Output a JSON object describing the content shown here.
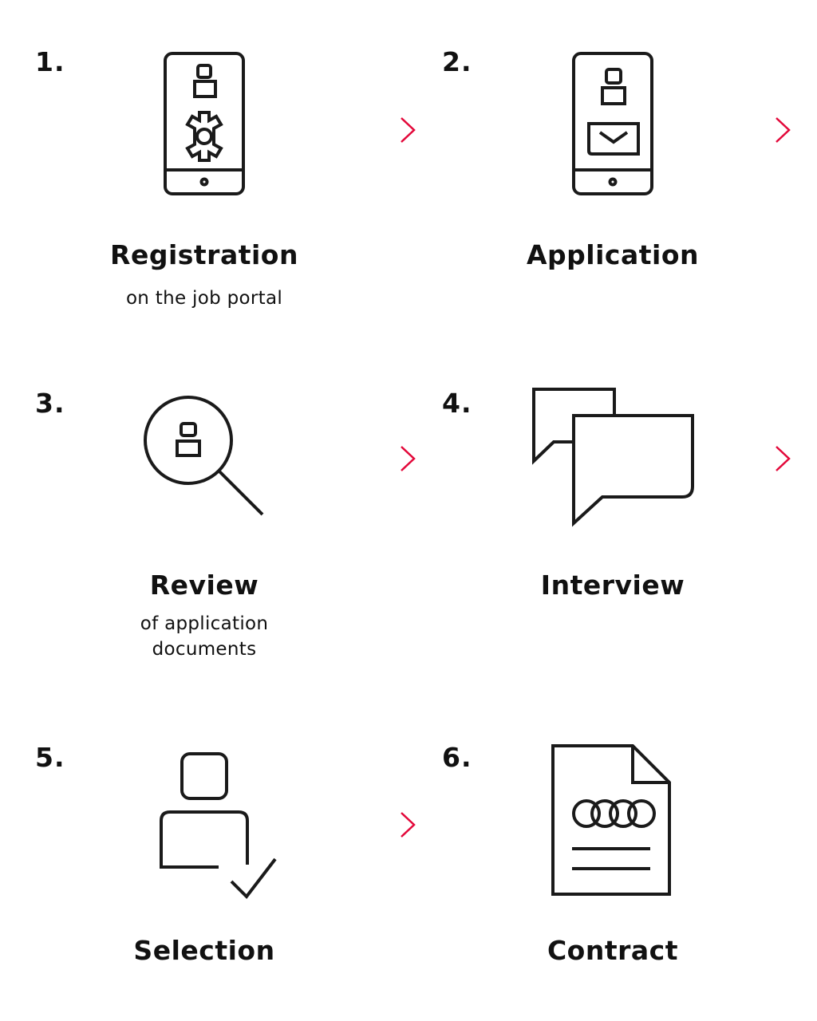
{
  "accent_color": "#e3083a",
  "stroke_color": "#1a1a1a",
  "steps": [
    {
      "number": "1.",
      "title": "Registration",
      "subtitle": "on the job portal",
      "icon": "smartphone-gear-icon",
      "next": "chevron-right-icon"
    },
    {
      "number": "2.",
      "title": "Application",
      "subtitle": "",
      "icon": "smartphone-mail-icon",
      "next": "chevron-right-icon"
    },
    {
      "number": "3.",
      "title": "Review",
      "subtitle_line1": "of application",
      "subtitle_line2": "documents",
      "icon": "magnifier-person-icon",
      "next": "chevron-right-icon"
    },
    {
      "number": "4.",
      "title": "Interview",
      "subtitle": "",
      "icon": "chat-bubbles-icon",
      "next": "chevron-right-icon"
    },
    {
      "number": "5.",
      "title": "Selection",
      "subtitle": "",
      "icon": "person-check-icon",
      "next": "chevron-right-icon"
    },
    {
      "number": "6.",
      "title": "Contract",
      "subtitle": "",
      "icon": "contract-document-icon"
    }
  ]
}
